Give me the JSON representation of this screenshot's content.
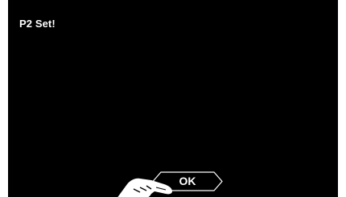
{
  "screen": {
    "title": "P2 Set!",
    "ok_label": "OK"
  },
  "icons": {
    "pointer": "pointing-hand-icon"
  },
  "colors": {
    "background": "#000000",
    "text": "#ffffff",
    "button_outline": "#ffffff"
  }
}
